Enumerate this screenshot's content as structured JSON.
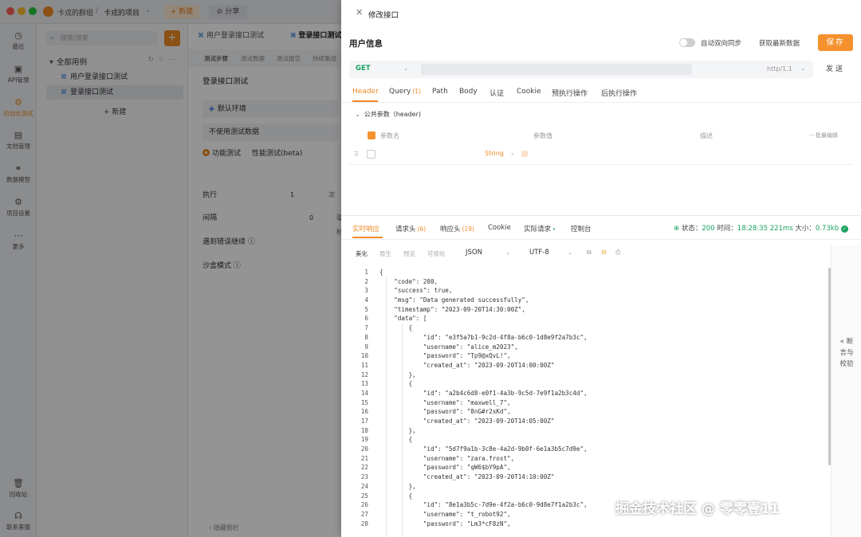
{
  "titlebar": {
    "team_name": "卡戎的群组",
    "separator": "/",
    "project_name": "卡戎的项目",
    "new_label": "+ 新建",
    "share_label": "⊘ 分享"
  },
  "sidebar": {
    "items": [
      {
        "label": "最近",
        "icon": "clock-icon"
      },
      {
        "label": "API管理",
        "icon": "api-icon"
      },
      {
        "label": "自动化测试",
        "icon": "automation-icon"
      },
      {
        "label": "文档管理",
        "icon": "document-icon"
      },
      {
        "label": "数据模型",
        "icon": "model-icon"
      },
      {
        "label": "项目设置",
        "icon": "settings-icon"
      },
      {
        "label": "更多",
        "icon": "more-icon"
      },
      {
        "label": "回收站",
        "icon": "trash-icon"
      },
      {
        "label": "联系客服",
        "icon": "support-icon"
      }
    ],
    "active_index": 2
  },
  "tree": {
    "search_placeholder": "搜索/搜索",
    "add_label": "+",
    "root_label": "全部用例",
    "cases": [
      "用户登录接口测试",
      "登录接口测试"
    ],
    "new_case_label": "+ 新建"
  },
  "main": {
    "tabs": [
      "用户登录接口测试",
      "登录接口测试"
    ],
    "subtabs": [
      "测试步骤",
      "测试数据",
      "测试报告",
      "持续集成"
    ],
    "title": "登录接口测试",
    "env_label": "默认环境",
    "data_label": "不使用测试数据",
    "mode_functional": "功能测试",
    "mode_performance": "性能测试(beta)",
    "params": [
      {
        "label": "执行",
        "value": "1",
        "unit": "次"
      },
      {
        "label": "间隔",
        "value": "0",
        "unit": "毫秒"
      }
    ],
    "continue_on_error": "遇到错误继续 ⓘ",
    "sandbox_mode": "沙盒模式 ⓘ",
    "footer": "‹ 隐藏侧栏"
  },
  "drawer": {
    "title": "修改接口",
    "name": "用户信息",
    "sync_label": "自动双向同步",
    "fetch_label": "获取最新数据",
    "save_label": "保存",
    "method": "GET",
    "http_version": "http/1.1",
    "send_label": "发送",
    "request_tabs": [
      {
        "label": "Header",
        "count": ""
      },
      {
        "label": "Query",
        "count": "(1)"
      },
      {
        "label": "Path",
        "count": ""
      },
      {
        "label": "Body",
        "count": ""
      },
      {
        "label": "认证",
        "count": ""
      },
      {
        "label": "Cookie",
        "count": ""
      },
      {
        "label": "预执行操作",
        "count": ""
      },
      {
        "label": "后执行操作",
        "count": ""
      }
    ],
    "public_params": "公共参数（header)",
    "header_columns": {
      "name": "参数名",
      "value": "参数值",
      "desc": "描述",
      "bulk": "··· 批量编辑"
    },
    "row_type": "String",
    "response_tabs": [
      {
        "label": "实时响应",
        "count": ""
      },
      {
        "label": "请求头",
        "count": "(6)"
      },
      {
        "label": "响应头",
        "count": "(19)"
      },
      {
        "label": "Cookie",
        "count": ""
      },
      {
        "label": "实际请求",
        "count": "•"
      },
      {
        "label": "控制台",
        "count": ""
      }
    ],
    "status": {
      "status_label": "状态：",
      "status_code": "200",
      "time_label": "时间：",
      "timestamp": "18:28:35",
      "duration": "221ms",
      "size_label": "大小：",
      "size": "0.73kb"
    },
    "format_tabs": [
      "美化",
      "原生",
      "预览",
      "可视化"
    ],
    "format": "JSON",
    "encoding": "UTF-8",
    "rail_label": "« 断言与校验",
    "code_lines": [
      "{",
      "    \"code\": 200,",
      "    \"success\": true,",
      "    \"msg\": \"Data generated successfully\",",
      "    \"timestamp\": \"2023-09-20T14:30:00Z\",",
      "    \"data\": [",
      "        {",
      "            \"id\": \"e3f5a7b1-9c2d-4f8a-b6c0-1d8e9f2a7b3c\",",
      "            \"username\": \"alice_m2023\",",
      "            \"password\": \"Tp9@xQvL!\",",
      "            \"created_at\": \"2023-09-20T14:00:00Z\"",
      "        },",
      "        {",
      "            \"id\": \"a2b4c6d8-e0f1-4a3b-9c5d-7e9f1a2b3c4d\",",
      "            \"username\": \"maxwell_7\",",
      "            \"password\": \"8nG#r2sKd\",",
      "            \"created_at\": \"2023-09-20T14:05:00Z\"",
      "        },",
      "        {",
      "            \"id\": \"5d7f9a1b-3c8e-4a2d-9b0f-6e1a3b5c7d9e\",",
      "            \"username\": \"zara.frost\",",
      "            \"password\": \"qW6$bY9pA\",",
      "            \"created_at\": \"2023-09-20T14:10:00Z\"",
      "        },",
      "        {",
      "            \"id\": \"8e1a3b5c-7d9e-4f2a-b6c0-9d8e7f1a2b3c\",",
      "            \"username\": \"t_robot92\",",
      "            \"password\": \"Lm3*cF8zN\","
    ]
  },
  "watermark": "掘金技术社区 @ 零零壹11"
}
